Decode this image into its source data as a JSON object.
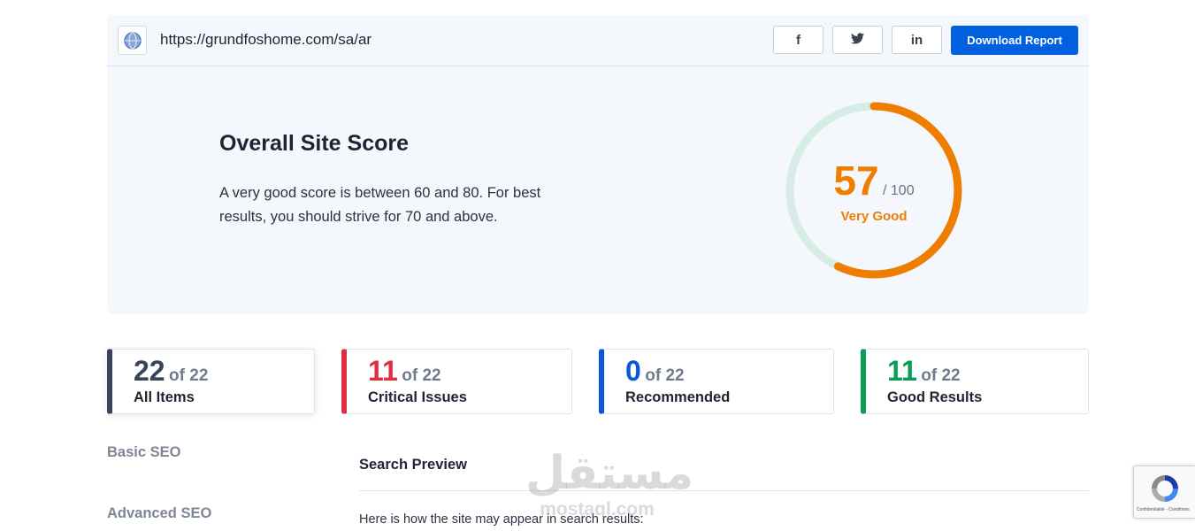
{
  "header": {
    "site_url": "https://grundfoshome.com/sa/ar",
    "site_icon": "globe-icon",
    "share": [
      {
        "name": "facebook",
        "icon": "facebook-icon",
        "glyph": "f"
      },
      {
        "name": "twitter",
        "icon": "twitter-icon",
        "glyph": "t"
      },
      {
        "name": "linkedin",
        "icon": "linkedin-icon",
        "glyph": "in"
      }
    ],
    "download_label": "Download Report"
  },
  "score": {
    "title": "Overall Site Score",
    "description": "A very good score is between 60 and 80. For best results, you should strive for 70 and above.",
    "value": "57",
    "max_label": "/ 100",
    "rating": "Very Good",
    "fraction": 0.57,
    "accent": "#ef7d00",
    "track": "#d5ede4"
  },
  "stats": [
    {
      "count": "22",
      "of": "of 22",
      "label": "All Items",
      "color": "#3a4458"
    },
    {
      "count": "11",
      "of": "of 22",
      "label": "Critical Issues",
      "color": "#dc2f45"
    },
    {
      "count": "0",
      "of": "of 22",
      "label": "Recommended",
      "color": "#0a58d6"
    },
    {
      "count": "11",
      "of": "of 22",
      "label": "Good Results",
      "color": "#0c9c56"
    }
  ],
  "sidebar": {
    "items": [
      {
        "label": "Basic SEO"
      },
      {
        "label": "Advanced SEO"
      }
    ]
  },
  "main": {
    "section_title": "Search Preview",
    "section_text": "Here is how the site may appear in search results:"
  },
  "watermark": {
    "arabic": "مستقل",
    "latin": "mostaql.com"
  },
  "recaptcha": {
    "icon": "recaptcha-icon",
    "footer": "Confidentialité - Conditions"
  }
}
